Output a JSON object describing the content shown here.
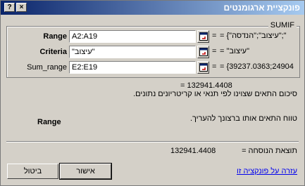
{
  "window": {
    "title": "פונקציית ארגומנטים",
    "help_glyph": "?",
    "close_glyph": "×"
  },
  "function_name": "SUMIF",
  "args": [
    {
      "label": "Range",
      "value": "A2:A19",
      "result": "= {\"עיצוב\";\"הנדסה\";\""
    },
    {
      "label": "Criteria",
      "value": "\"עיצוב\"",
      "result": "= \"עיצוב\""
    },
    {
      "label": "Sum_range",
      "value": "E2:E19",
      "result": "= {39237.0363;24904"
    }
  ],
  "result_line": "= 132941.4408",
  "description": "סיכום התאים שצוינו לפי תנאי או קריטריונים נתונים.",
  "current_arg": {
    "name": "Range",
    "description": "טווח התאים אותו ברצונך להעריך."
  },
  "formula_result": {
    "label": "תוצאת הנוסחה =",
    "value": "132941.4408"
  },
  "help_link": "עזרה על פונקציה זו",
  "buttons": {
    "ok": "אישור",
    "cancel": "ביטול"
  },
  "colors": {
    "titlebar_start": "#0a246a",
    "titlebar_end": "#a6caf0",
    "face": "#d4d0c8",
    "link": "#0000ee"
  }
}
